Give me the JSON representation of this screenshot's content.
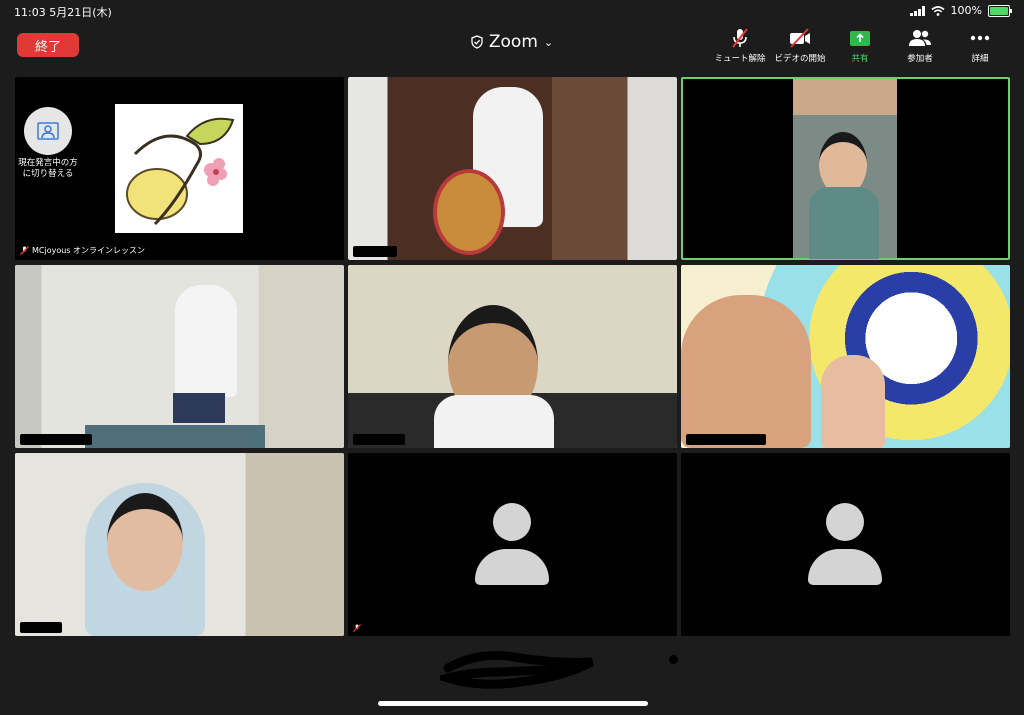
{
  "status": {
    "time_date": "11:03   5月21日(木)",
    "battery": "100%"
  },
  "topbar": {
    "end_label": "終了",
    "title": "Zoom",
    "tools": [
      {
        "label": "ミュート解除",
        "icon": "mic-muted-icon"
      },
      {
        "label": "ビデオの開始",
        "icon": "video-off-icon"
      },
      {
        "label": "共有",
        "icon": "share-icon"
      },
      {
        "label": "参加者",
        "icon": "participants-icon"
      },
      {
        "label": "詳細",
        "icon": "more-icon"
      }
    ]
  },
  "colors": {
    "end_button": "#e03a37",
    "active_speaker": "#6ecf6e",
    "share": "#2fb84c"
  },
  "tiles": [
    {
      "name": "MCjoyous オンラインレッスン",
      "switch_label": "現在発言中の方に切り替える",
      "type": "logo"
    },
    {
      "name": "",
      "type": "video"
    },
    {
      "name": "",
      "type": "video",
      "active_speaker": true
    },
    {
      "name": "",
      "type": "video"
    },
    {
      "name": "",
      "type": "video"
    },
    {
      "name": "",
      "type": "video"
    },
    {
      "name": "",
      "type": "video"
    },
    {
      "name": "",
      "type": "avatar"
    },
    {
      "name": "",
      "type": "avatar"
    }
  ]
}
